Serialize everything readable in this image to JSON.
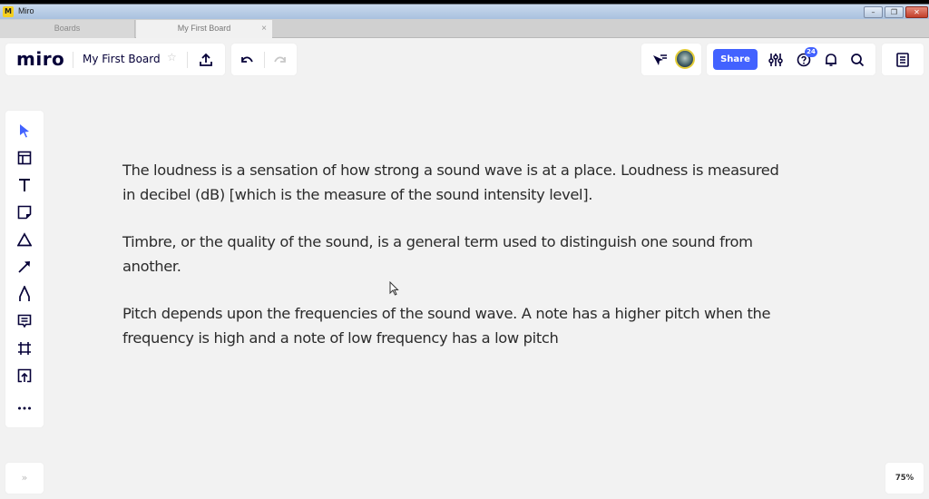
{
  "window": {
    "title": "Miro",
    "app_icon": "miro-app-icon",
    "controls": [
      "minimize",
      "restore",
      "close"
    ]
  },
  "tabs": [
    {
      "label": "Boards",
      "active": false
    },
    {
      "label": "My First Board",
      "active": true,
      "close_icon": "×"
    }
  ],
  "header": {
    "logo": "miro",
    "board_name": "My First Board",
    "star_icon": "☆",
    "export_icon": "upload-icon",
    "undo_icon": "undo-icon",
    "redo_icon": "redo-icon",
    "cursor_filter_icon": "cursor-tracking-icon",
    "share_label": "Share",
    "settings_icon": "sliders-icon",
    "help_icon": "help-icon",
    "help_badge": "24",
    "notifications_icon": "bell-icon",
    "search_icon": "search-icon",
    "notes_icon": "notes-icon",
    "accent_color": "#4262ff"
  },
  "toolbar": {
    "tools": [
      {
        "name": "select",
        "icon": "cursor-icon",
        "active": true
      },
      {
        "name": "templates",
        "icon": "template-icon"
      },
      {
        "name": "text",
        "icon": "text-icon"
      },
      {
        "name": "sticky-note",
        "icon": "sticky-note-icon"
      },
      {
        "name": "shapes",
        "icon": "triangle-icon"
      },
      {
        "name": "connection-line",
        "icon": "arrow-icon"
      },
      {
        "name": "pen",
        "icon": "pen-icon"
      },
      {
        "name": "comment",
        "icon": "comment-icon"
      },
      {
        "name": "frame",
        "icon": "frame-icon"
      },
      {
        "name": "upload",
        "icon": "upload-box-icon"
      },
      {
        "name": "more",
        "icon": "more-icon"
      }
    ]
  },
  "board": {
    "paragraphs": [
      {
        "lines": [
          "The loudness is a sensation of how strong a sound wave is at a place. Loudness is measured",
          "in decibel (dB) [which is the measure of the sound intensity level]."
        ]
      },
      {
        "lines": [
          "Timbre, or the quality of the sound, is a general term used to distinguish one sound from",
          "another."
        ]
      },
      {
        "lines": [
          "Pitch depends upon the frequencies of the sound wave. A note has a higher pitch when the",
          "frequency is high and a note of low frequency has a low pitch"
        ]
      }
    ]
  },
  "footer": {
    "collapse_icon": "»",
    "zoom_level": "75%"
  }
}
